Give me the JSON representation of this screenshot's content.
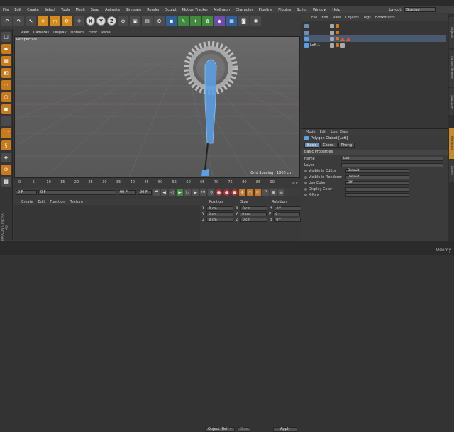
{
  "menu": [
    "File",
    "Edit",
    "Create",
    "Select",
    "Tools",
    "Mesh",
    "Snap",
    "Animate",
    "Simulate",
    "Render",
    "Sculpt",
    "Motion Tracker",
    "MoGraph",
    "Character",
    "Pipeline",
    "Plugins",
    "Script",
    "Window",
    "Help"
  ],
  "layout": {
    "label": "Layout:",
    "value": "Startup"
  },
  "toolbar": {
    "x": "X",
    "y": "Y",
    "z": "Z"
  },
  "viewport": {
    "menu": [
      "View",
      "Cameras",
      "Display",
      "Options",
      "Filter",
      "Panel"
    ],
    "label": "Perspective",
    "grid_spacing": "Grid Spacing : 1000 cm"
  },
  "timeline": {
    "ticks": [
      "0",
      "5",
      "10",
      "15",
      "20",
      "25",
      "30",
      "35",
      "40",
      "45",
      "50",
      "55",
      "60",
      "65",
      "70",
      "75",
      "80",
      "85",
      "90"
    ],
    "frame": "0 F",
    "start": "0 F",
    "current": "0 F",
    "end_a": "90 F",
    "end_b": "90 F"
  },
  "material": {
    "menu": [
      "Create",
      "Edit",
      "Function",
      "Texture"
    ]
  },
  "coords": {
    "headers": [
      "Position",
      "Size",
      "Rotation"
    ],
    "rows": [
      {
        "axis": "X",
        "pos": "0 cm",
        "size": "0 cm",
        "rot_axis": "H",
        "rot": "0 °"
      },
      {
        "axis": "Y",
        "pos": "0 cm",
        "size": "0 cm",
        "rot_axis": "P",
        "rot": "0 °"
      },
      {
        "axis": "Z",
        "pos": "0 cm",
        "size": "0 cm",
        "rot_axis": "B",
        "rot": "0 °"
      }
    ],
    "mode": "Object (Rel) ▾",
    "size_mode": "Size",
    "apply": "Apply"
  },
  "objects": {
    "menu": [
      "File",
      "Edit",
      "View",
      "Objects",
      "Tags",
      "Bookmarks"
    ],
    "items": [
      "",
      "",
      "",
      "Loft.1"
    ]
  },
  "attributes": {
    "menu": [
      "Mode",
      "Edit",
      "User Data"
    ],
    "title": "Polygon Object [Loft]",
    "tabs": [
      "Basic",
      "Coord.",
      "Phong"
    ],
    "section": "Basic Properties",
    "rows": [
      {
        "label": "Name",
        "value": "Loft"
      },
      {
        "label": "Layer",
        "value": ""
      },
      {
        "label": "Visible in Editor",
        "value": "Default"
      },
      {
        "label": "Visible in Renderer",
        "value": "Default"
      },
      {
        "label": "Use Color",
        "value": "Off"
      },
      {
        "label": "Display Color",
        "value": ""
      },
      {
        "label": "X-Ray",
        "value": ""
      }
    ]
  },
  "sidetabs": [
    "Objects",
    "Content Browser",
    "Structure",
    "Attributes",
    "Layers"
  ],
  "branding": {
    "maxon": "MAXON CINEMA 4D",
    "udemy": "Udemy"
  },
  "colors": {
    "accent": "#d68a1c",
    "selection": "#6e8fb8",
    "object": "#5aa0e6"
  }
}
